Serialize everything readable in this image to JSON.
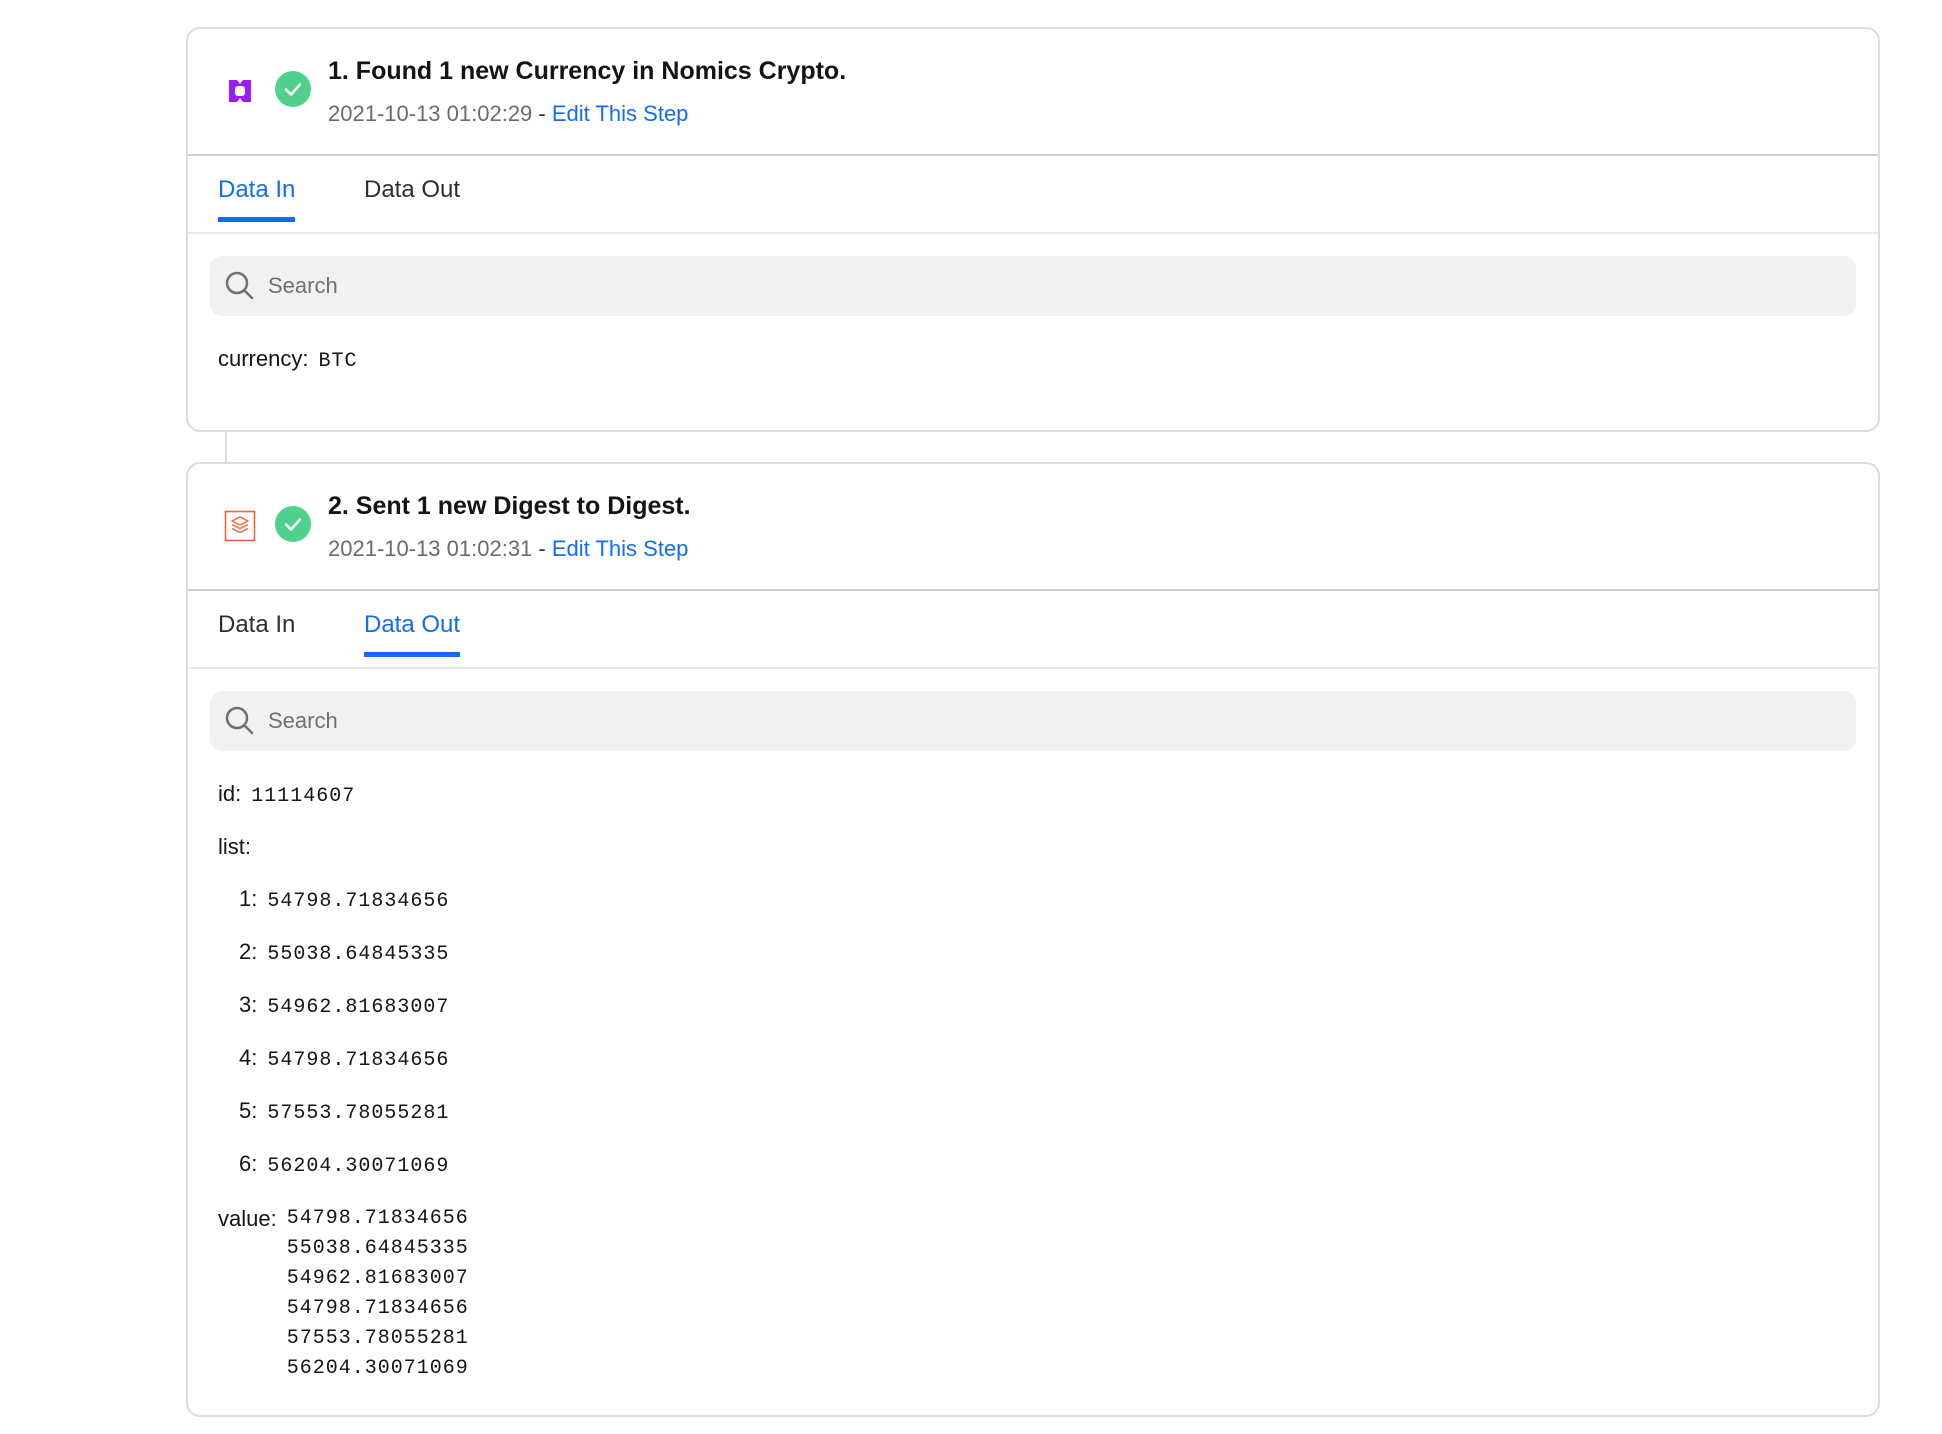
{
  "steps": [
    {
      "title": "1. Found 1 new Currency in Nomics Crypto.",
      "timestamp": "2021-10-13 01:02:29",
      "separator": " - ",
      "edit_label": "Edit This Step",
      "icon": "nomics-icon",
      "tabs": [
        {
          "label": "Data In",
          "active": true
        },
        {
          "label": "Data Out",
          "active": false
        }
      ],
      "search": {
        "placeholder": "Search",
        "value": ""
      },
      "fields": {
        "currency": {
          "key": "currency:",
          "value": "BTC"
        }
      }
    },
    {
      "title": "2. Sent 1 new Digest to Digest.",
      "timestamp": "2021-10-13 01:02:31",
      "separator": " - ",
      "edit_label": "Edit This Step",
      "icon": "digest-icon",
      "tabs": [
        {
          "label": "Data In",
          "active": false
        },
        {
          "label": "Data Out",
          "active": true
        }
      ],
      "search": {
        "placeholder": "Search",
        "value": ""
      },
      "fields": {
        "id": {
          "key": "id:",
          "value": "11114607"
        },
        "list": {
          "key": "list:",
          "items": [
            {
              "key": "1:",
              "value": "54798.71834656"
            },
            {
              "key": "2:",
              "value": "55038.64845335"
            },
            {
              "key": "3:",
              "value": "54962.81683007"
            },
            {
              "key": "4:",
              "value": "54798.71834656"
            },
            {
              "key": "5:",
              "value": "57553.78055281"
            },
            {
              "key": "6:",
              "value": "56204.30071069"
            }
          ]
        },
        "value": {
          "key": "value:",
          "lines": [
            "54798.71834656",
            "55038.64845335",
            "54962.81683007",
            "54798.71834656",
            "57553.78055281",
            "56204.30071069"
          ]
        }
      }
    }
  ],
  "colors": {
    "accent": "#136bf5",
    "success": "#4fd18b",
    "nomics": "#9b1cf5",
    "digest": "#f0643c"
  }
}
